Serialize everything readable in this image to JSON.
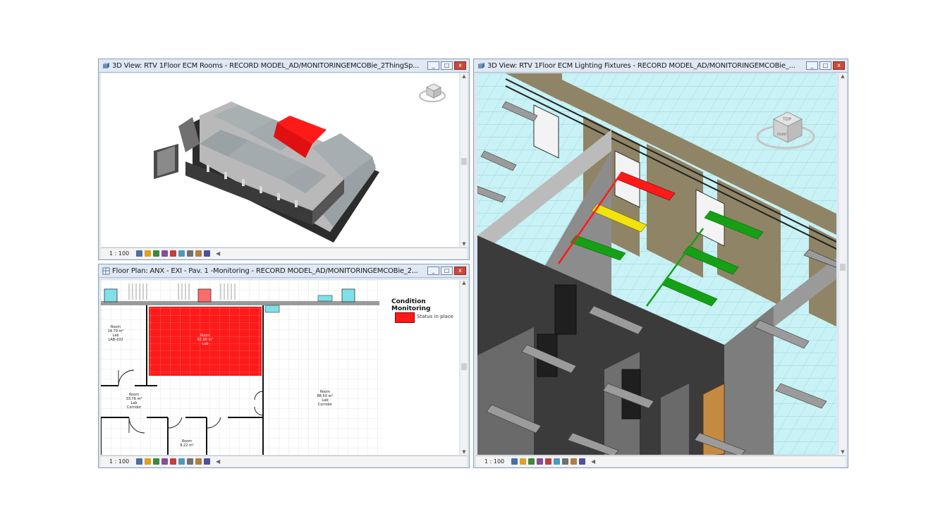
{
  "colors": {
    "red": "#ff1a1a",
    "yellow": "#f2e20e",
    "green": "#16a016",
    "wall": "#8f8466",
    "floor": "#c8f2f5"
  },
  "windows": [
    {
      "title": "3D View: RTV 1Floor ECM Rooms - RECORD MODEL_AD/MONITORINGEMCOBie_2ThingSp...",
      "scale": "1 : 100"
    },
    {
      "title": "Floor Plan: ANX - EXI - Pav. 1 -Monitoring - RECORD MODEL_AD/MONITORINGEMCOBie_2...",
      "scale": "1 : 100",
      "legend": {
        "title": "Condition Monitoring",
        "item": "Status in place"
      },
      "rooms": [
        {
          "name": "Room",
          "area": "14.79 m²",
          "use": "Lab",
          "id": "LAB-102"
        },
        {
          "name": "Room",
          "area": "62.88 m²",
          "use": "Lab"
        },
        {
          "name": "Room",
          "area": "33.76 m²",
          "use": "Lab",
          "id": "Corridor"
        },
        {
          "name": "Room",
          "area": "88.50 m²",
          "use": "Lab",
          "id": "Corridor"
        },
        {
          "name": "Room",
          "area": "9.22 m²"
        }
      ]
    },
    {
      "title": "3D View: RTV 1Floor ECM Lighting Fixtures - RECORD MODEL_AD/MONITORINGEMCOBie_...",
      "scale": "1 : 100"
    }
  ],
  "window_controls": {
    "minimize": "_",
    "maximize": "□",
    "close": "x"
  },
  "viewcube": {
    "face": "TOP",
    "side": "FRONT"
  },
  "tools": [
    "#4a6fa5",
    "#e0a020",
    "#3a8a3a",
    "#8a4a9a",
    "#c04040",
    "#4a9ac0",
    "#707070",
    "#b08040",
    "#5050a0"
  ]
}
